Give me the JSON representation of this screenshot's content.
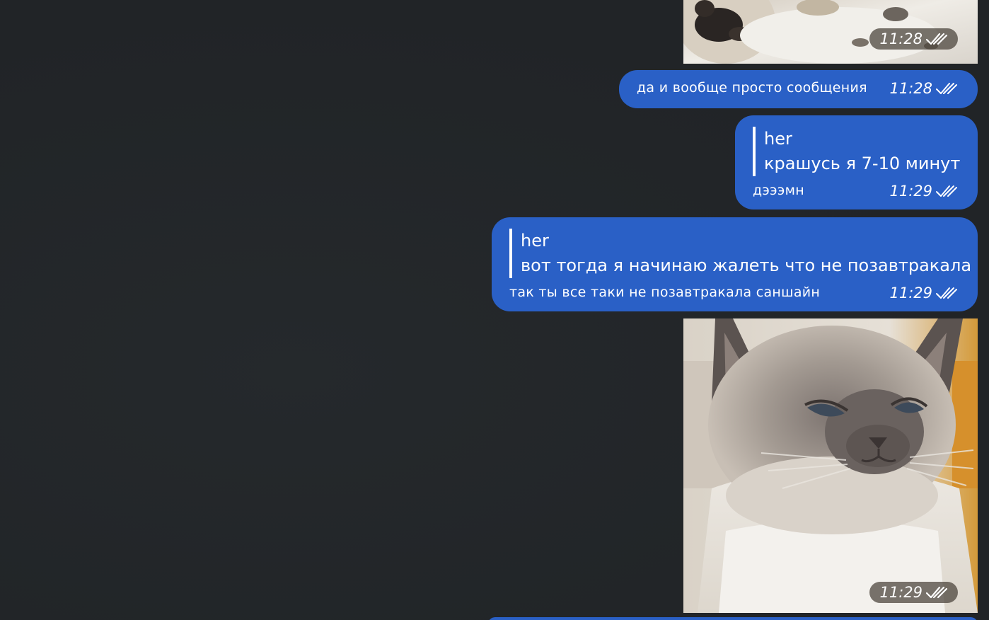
{
  "messages": [
    {
      "type": "photo",
      "subject": "cat photo (partial, top)",
      "time": "11:28"
    },
    {
      "type": "text",
      "text": "да и вообще просто сообщения",
      "time": "11:28"
    },
    {
      "type": "reply",
      "quote_author": "her",
      "quote_text": "крашусь я 7-10 минут",
      "text": "дэээмн",
      "time": "11:29"
    },
    {
      "type": "reply",
      "quote_author": "her",
      "quote_text": "вот тогда я начинаю жалеть что не позавтракала",
      "text": "так ты все таки не позавтракала саншайн",
      "time": "11:29"
    },
    {
      "type": "photo",
      "subject": "grumpy siamese cat photo",
      "time": "11:29"
    }
  ],
  "colors": {
    "background": "#222528",
    "outgoing_bubble": "#2a60c6",
    "text": "#ffffff"
  },
  "icons": {
    "read_status": "double-check-icon"
  }
}
